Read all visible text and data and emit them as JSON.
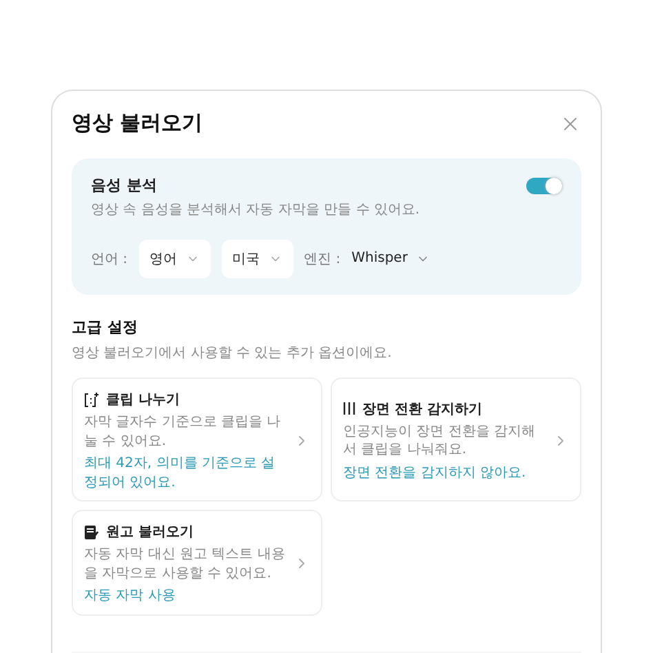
{
  "dialog": {
    "title": "영상 불러오기"
  },
  "voice_analysis": {
    "title": "음성 분석",
    "description": "영상 속 음성을 분석해서 자동 자막을 만들 수 있어요.",
    "on": true,
    "language_label": "언어 :",
    "language": "영어",
    "region": "미국",
    "engine_label": "엔진 :",
    "engine": "Whisper"
  },
  "advanced": {
    "title": "고급 설정",
    "description": "영상 불러오기에서 사용할 수 있는 추가 옵션이에요.",
    "cards": [
      {
        "kind": "split",
        "title": "클립 나누기",
        "description": "자막 글자수 기준으로 클립을 나눌 수 있어요.",
        "status": "최대 42자, 의미를 기준으로 설정되어 있어요."
      },
      {
        "kind": "scene",
        "title": "장면 전환 감지하기",
        "description": "인공지능이 장면 전환을 감지해서 클립을 나눠줘요.",
        "status": "장면 전환을 감지하지 않아요."
      },
      {
        "kind": "script",
        "title": "원고 불러오기",
        "description": "자동 자막 대신 원고 텍스트 내용을 자막으로 사용할 수 있어요.",
        "status": "자동 자막 사용"
      }
    ]
  }
}
